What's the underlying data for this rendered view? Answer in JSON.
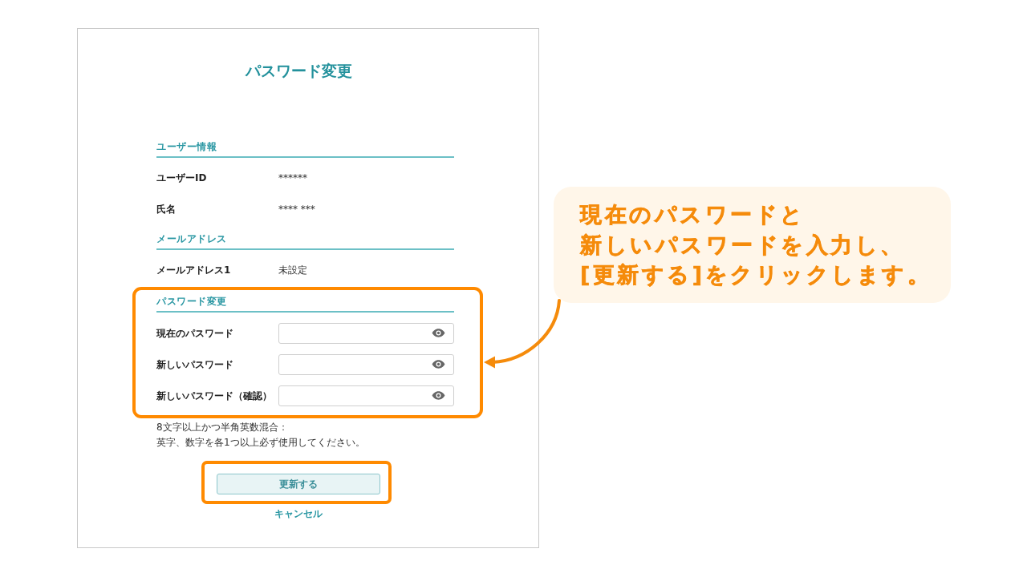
{
  "form": {
    "title": "パスワード変更",
    "sections": [
      {
        "kind": "info",
        "heading": "ユーザー情報",
        "rows": [
          {
            "label": "ユーザーID",
            "value": "******"
          },
          {
            "label": "氏名",
            "value": "**** ***"
          }
        ]
      },
      {
        "kind": "info",
        "heading": "メールアドレス",
        "rows": [
          {
            "label": "メールアドレス1",
            "value": "未設定"
          }
        ]
      },
      {
        "kind": "password",
        "heading": "パスワード変更",
        "highlighted": true,
        "fields": [
          {
            "label": "現在のパスワード"
          },
          {
            "label": "新しいパスワード"
          },
          {
            "label": "新しいパスワード（確認）"
          }
        ]
      }
    ],
    "password_hint": [
      "8文字以上かつ半角英数混合：",
      "英字、数字を各1つ以上必ず使用してください。"
    ],
    "submit_button": {
      "label": "更新する",
      "highlighted": true
    },
    "cancel_link": "キャンセル"
  },
  "callout": {
    "lines": [
      "現在のパスワードと",
      "新しいパスワードを入力し、",
      "[更新する]をクリックします。"
    ]
  }
}
